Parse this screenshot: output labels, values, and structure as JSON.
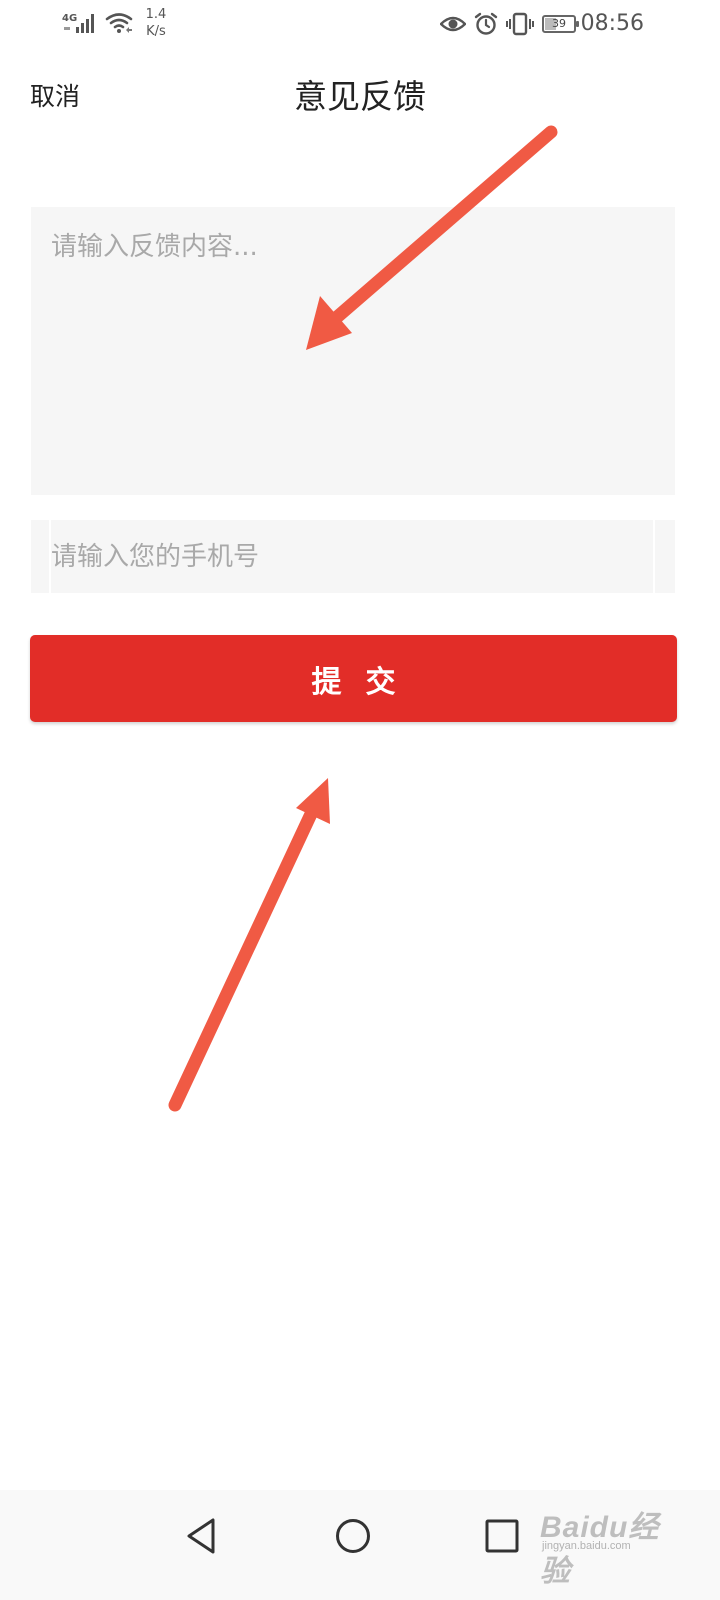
{
  "status_bar": {
    "network_type": "4G",
    "speed_value": "1.4",
    "speed_unit": "K/s",
    "battery": "39",
    "battery_level": 0.39,
    "time": "08:56",
    "icons": [
      "signal-icon",
      "wifi-icon",
      "eye-icon",
      "alarm-icon",
      "vibrate-icon",
      "battery-icon"
    ]
  },
  "header": {
    "cancel_label": "取消",
    "title": "意见反馈"
  },
  "form": {
    "feedback_placeholder": "请输入反馈内容...",
    "feedback_value": "",
    "phone_placeholder": "请输入您的手机号",
    "phone_value": "",
    "submit_label": "提交"
  },
  "nav_bar": {
    "icons": [
      "back-icon",
      "home-icon",
      "recent-apps-icon"
    ]
  },
  "watermark": {
    "main": "Baidu经验",
    "sub": "jingyan.baidu.com"
  },
  "colors": {
    "accent": "#e22d28",
    "arrow": "#f05a44",
    "input_bg": "#f6f6f6",
    "placeholder": "#a9a9a9"
  }
}
